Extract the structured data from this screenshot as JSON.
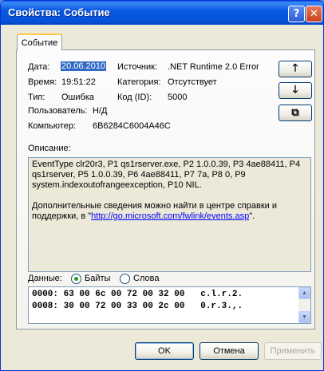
{
  "window": {
    "title": "Свойства: Событие",
    "help_glyph": "?",
    "close_glyph": "✕"
  },
  "tab": {
    "label": "Событие"
  },
  "event": {
    "date_label": "Дата:",
    "date": "20.06.2010",
    "source_label": "Источник:",
    "source": ".NET Runtime 2.0 Error",
    "time_label": "Время:",
    "time": "19:51:22",
    "category_label": "Категория:",
    "category": "Отсутствует",
    "type_label": "Тип:",
    "type": "Ошибка",
    "code_label": "Код (ID):",
    "code": "5000",
    "user_label": "Пользователь:",
    "user": "Н/Д",
    "computer_label": "Компьютер:",
    "computer": "6B6284C6004A46C"
  },
  "side_buttons": {
    "up": "🡑",
    "down": "🡓",
    "copy": "⧉"
  },
  "description": {
    "label": "Описание:",
    "line1": "EventType clr20r3, P1 qs1rserver.exe, P2 1.0.0.39, P3 4ae88411, P4 qs1rserver, P5 1.0.0.39, P6 4ae88411, P7 7a, P8 0, P9 system.indexoutofrangeexception, P10 NIL.",
    "line2_prefix": "Дополнительные сведения можно найти в центре справки и поддержки, в \"",
    "link": "http://go.microsoft.com/fwlink/events.asp",
    "line2_suffix": "\"."
  },
  "data": {
    "label": "Данные:",
    "bytes_label": "Байты",
    "words_label": "Слова",
    "selected": "bytes",
    "rows": [
      "0000: 63 00 6c 00 72 00 32 00   c.l.r.2.",
      "0008: 30 00 72 00 33 00 2c 00   0.r.3.,."
    ]
  },
  "buttons": {
    "ok": "OK",
    "cancel": "Отмена",
    "apply": "Применить"
  }
}
